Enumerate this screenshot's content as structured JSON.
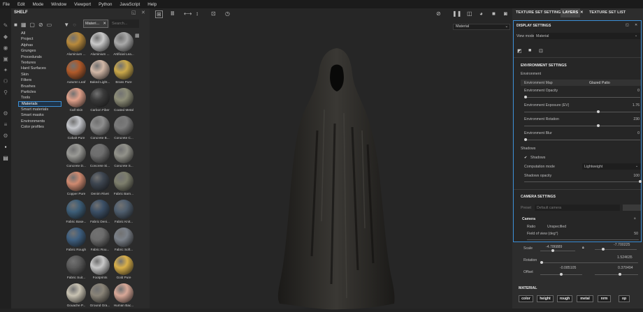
{
  "menubar": [
    "File",
    "Edit",
    "Mode",
    "Window",
    "Viewport",
    "Python",
    "JavaScript",
    "Help"
  ],
  "shelf": {
    "title": "SHELF",
    "filter_chip": "Materi...",
    "search_placeholder": "Search...",
    "categories": [
      {
        "label": "All"
      },
      {
        "label": "Project"
      },
      {
        "label": "Alphas"
      },
      {
        "label": "Grunges"
      },
      {
        "label": "Procedurals"
      },
      {
        "label": "Textures"
      },
      {
        "label": "Hard Surfaces"
      },
      {
        "label": "Skin"
      },
      {
        "label": "Filters"
      },
      {
        "label": "Brushes"
      },
      {
        "label": "Particles"
      },
      {
        "label": "Tools"
      },
      {
        "label": "Materials",
        "selected": true
      },
      {
        "label": "Smart materials"
      },
      {
        "label": "Smart masks"
      },
      {
        "label": "Environments"
      },
      {
        "label": "Color profiles"
      }
    ],
    "materials": [
      {
        "label": "Aluminium ...",
        "color": "#b88a3c"
      },
      {
        "label": "Aluminium ...",
        "color": "#c9c9c9"
      },
      {
        "label": "Artificial Lea...",
        "color": "#a9a9a9"
      },
      {
        "label": "Autumn Leaf",
        "color": "#b05a2a"
      },
      {
        "label": "Baked Light...",
        "color": "#d1b7a6"
      },
      {
        "label": "Brass Pure",
        "color": "#caa84a"
      },
      {
        "label": "Calf Skin",
        "color": "#e0a08a"
      },
      {
        "label": "Carbon Fiber",
        "color": "#3a3a3a"
      },
      {
        "label": "Coated Metal",
        "color": "#8d8d77"
      },
      {
        "label": "Cobalt Pure",
        "color": "#c4c6cb"
      },
      {
        "label": "Concrete B...",
        "color": "#8e8e8e"
      },
      {
        "label": "Concrete C...",
        "color": "#7a7a7a"
      },
      {
        "label": "Concrete D...",
        "color": "#9a9a96"
      },
      {
        "label": "Concrete Si...",
        "color": "#6e6e6e"
      },
      {
        "label": "Concrete S...",
        "color": "#92928a"
      },
      {
        "label": "Copper Pure",
        "color": "#d08a70"
      },
      {
        "label": "Denim Rivet",
        "color": "#3d4550"
      },
      {
        "label": "Fabric Barn...",
        "color": "#7d7e6c"
      },
      {
        "label": "Fabric Base...",
        "color": "#3d5e78"
      },
      {
        "label": "Fabric Deni...",
        "color": "#3b4f66"
      },
      {
        "label": "Fabric Knit...",
        "color": "#4f5e6e"
      },
      {
        "label": "Fabric Rough",
        "color": "#3e5f80"
      },
      {
        "label": "Fabric Rou...",
        "color": "#6c6c6c"
      },
      {
        "label": "Fabric Soft...",
        "color": "#7a8088"
      },
      {
        "label": "Fabric Suit...",
        "color": "#5a5a5a"
      },
      {
        "label": "Footprints",
        "color": "#c8c8c8"
      },
      {
        "label": "Gold Pure",
        "color": "#d9b04a"
      },
      {
        "label": "Gouache P...",
        "color": "#c9c3b3"
      },
      {
        "label": "Ground Gra...",
        "color": "#8a8478"
      },
      {
        "label": "Human Bac...",
        "color": "#d8a898"
      }
    ]
  },
  "viewport": {
    "select_value": "Material"
  },
  "tabs": [
    {
      "label": "TEXTURE SET SETTINGS"
    },
    {
      "label": "LAYERS"
    },
    {
      "label": "TEXTURE SET LIST"
    }
  ],
  "display_settings": {
    "title": "DISPLAY SETTINGS",
    "view_mode_label": "View mode",
    "view_mode_value": "Material",
    "env_header": "ENVIRONMENT SETTINGS",
    "env_group": "Environment",
    "env_map_label": "Environment Map",
    "env_map_value": "Glazed Patio",
    "env_opacity_label": "Environment Opacity",
    "env_opacity_value": "0",
    "env_exposure_label": "Environment Exposure (EV)",
    "env_exposure_value": "1.76",
    "env_rotation_label": "Environment Rotation",
    "env_rotation_value": "230",
    "env_blur_label": "Environment Blur",
    "env_blur_value": "0",
    "shadows_group": "Shadows",
    "shadows_check_label": "Shadows",
    "comp_mode_label": "Computation mode",
    "comp_mode_value": "Lightweight",
    "shadows_opacity_label": "Shadows opacity",
    "shadows_opacity_value": "100",
    "cam_header": "CAMERA SETTINGS",
    "preset_label": "Preset",
    "preset_placeholder": "Default camera",
    "camera_group": "Camera",
    "ratio_label": "Ratio",
    "ratio_value": "Unspecified",
    "fov_label": "Field of view (deg°)",
    "fov_value": "50"
  },
  "levels": {
    "env_exposure": 0.64,
    "env_rotation": 0.64,
    "shadows_opacity": 1.0
  },
  "transform": {
    "scale_label": "Scale",
    "scale_x": "-4.786889",
    "scale_y": "-7.700225",
    "rotation_label": "Rotation",
    "rotation_value": "1.524635",
    "offset_label": "Offset",
    "offset_x": "-0.085105",
    "offset_y": "0.370494"
  },
  "material_section": {
    "title": "MATERIAL",
    "channels": [
      "color",
      "height",
      "rough",
      "metal",
      "nrm",
      "op"
    ]
  }
}
